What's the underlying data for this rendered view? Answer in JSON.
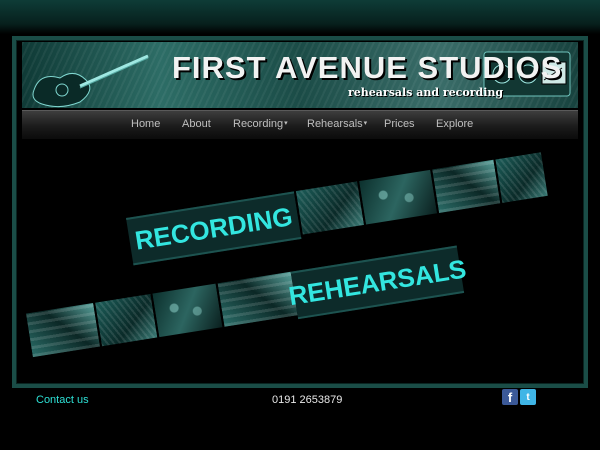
{
  "banner": {
    "title": "FIRST AVENUE STUDIOS",
    "subtitle": "rehearsals and recording"
  },
  "nav": {
    "items": [
      {
        "label": "Home",
        "has_dropdown": false
      },
      {
        "label": "About",
        "has_dropdown": false
      },
      {
        "label": "Recording",
        "has_dropdown": true
      },
      {
        "label": "Rehearsals",
        "has_dropdown": true
      },
      {
        "label": "Prices",
        "has_dropdown": false
      },
      {
        "label": "Explore",
        "has_dropdown": false
      }
    ],
    "dropdown_marker": "▾"
  },
  "promo": {
    "recording_label": "RECORDING",
    "rehearsals_label": "REHEARSALS"
  },
  "footer": {
    "contact_label": "Contact us",
    "phone": "0191 2653879"
  },
  "social": {
    "facebook_glyph": "f",
    "twitter_glyph": "t"
  },
  "colors": {
    "accent": "#33e6e0",
    "frame": "#1a4d47",
    "facebook": "#3b5998",
    "twitter": "#3fb5e6"
  }
}
